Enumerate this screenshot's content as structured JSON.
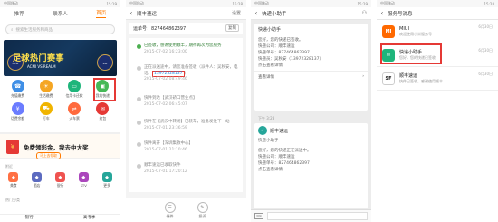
{
  "p1": {
    "status_left": "中国移动",
    "status_right": "15:19",
    "tabs": [
      "推荐",
      "联系人",
      "首页"
    ],
    "search_placeholder": "搜索生活服务和商品",
    "banner_title": "足球热门赛事",
    "banner_sub": "ACMI  VS  REALM",
    "grid": [
      {
        "label": "充值缴费",
        "color": "#3f8fe6",
        "icon": "phone-icon"
      },
      {
        "label": "生活缴费",
        "color": "#f5a623",
        "icon": "bulb-icon"
      },
      {
        "label": "信用卡还款",
        "color": "#1fb57b",
        "icon": "card-icon"
      },
      {
        "label": "我的快递",
        "color": "#46b958",
        "icon": "parcel-icon"
      },
      {
        "label": "话费余额",
        "color": "#6b7cff",
        "icon": "coin-icon"
      },
      {
        "label": "打车",
        "color": "#f0b400",
        "icon": "car-icon"
      },
      {
        "label": "火车票",
        "color": "#ff6a3d",
        "icon": "train-icon"
      },
      {
        "label": "红包",
        "color": "#e53935",
        "icon": "gift-icon"
      }
    ],
    "promo_text": "免费领彩金，我去中大奖",
    "promo_btn": "马上去领取",
    "section1": "附近",
    "grid2": [
      {
        "label": "美食",
        "color": "#ff7043"
      },
      {
        "label": "酒店",
        "color": "#5c6bc0"
      },
      {
        "label": "银行",
        "color": "#ef5350"
      },
      {
        "label": "KTV",
        "color": "#ab47bc"
      },
      {
        "label": "更多",
        "color": "#26a69a"
      }
    ],
    "section2": "热门分类",
    "bottom": [
      "银行",
      "高考季"
    ]
  },
  "p2": {
    "status_left": "中国移动",
    "status_right": "15:28",
    "title": "顺丰速运",
    "right_btn": "设置",
    "order_label": "运单号：827464862397",
    "copy_label": "复制",
    "events": [
      {
        "text": "已签收，感谢使用顺丰，期待再次为您服务",
        "date": "2015-07-02 16:23:00"
      },
      {
        "text": "正在派送途中，请您准备签收（派件人：吴秋安，电话：13972328137）",
        "date": "2015-07-02 08:49:46"
      },
      {
        "text": "快件到达【武汉硚口营业点】",
        "date": "2015-07-02 06:45:07"
      },
      {
        "text": "快件在【武汉中转场】已装车，准备发往下一站",
        "date": "2015-07-01 23:36:59"
      },
      {
        "text": "快件离开【深圳集散中心】",
        "date": "2015-07-01 21:10:46"
      },
      {
        "text": "顺丰速运已收取快件",
        "date": "2015-07-01 17:20:12"
      }
    ],
    "bottom": [
      "催件",
      "投诉"
    ]
  },
  "p3": {
    "status_left": "中国移动",
    "status_right": "15:29",
    "title": "快递小助手",
    "card1": {
      "title": "快递小助手",
      "lines": [
        "您好，您的快递已签收。",
        "快递公司：顺丰速运",
        "快递单号：827464862397",
        "快递员：吴秋安（13972328137）",
        "点击查看详情"
      ],
      "foot": "查看详情"
    },
    "time": "下午 3:28",
    "card2": {
      "head": "顺丰速运",
      "title": "快递小助手",
      "lines": [
        "您好，您的快递正在派送中。",
        "快递公司：顺丰速运",
        "快递单号：827464862397",
        "点击查看详情"
      ],
      "foot": "查看详情"
    }
  },
  "p4": {
    "status_left": "中国移动",
    "status_right": "15:28",
    "title": "服务号消息",
    "accounts": [
      {
        "name": "MIUI",
        "msg": "欢迎使用小米服务号",
        "date": "6月30日",
        "color": "#ff6900",
        "icon": "MI"
      },
      {
        "name": "快递小助手",
        "msg": "您好，您的快递已签收",
        "date": "6月30日",
        "color": "#1fb57b",
        "icon": "✉"
      },
      {
        "name": "顺丰速运",
        "msg": "快件已签收，感谢使用顺丰",
        "date": "6月30日",
        "color": "#222222",
        "icon": "SF"
      }
    ]
  }
}
